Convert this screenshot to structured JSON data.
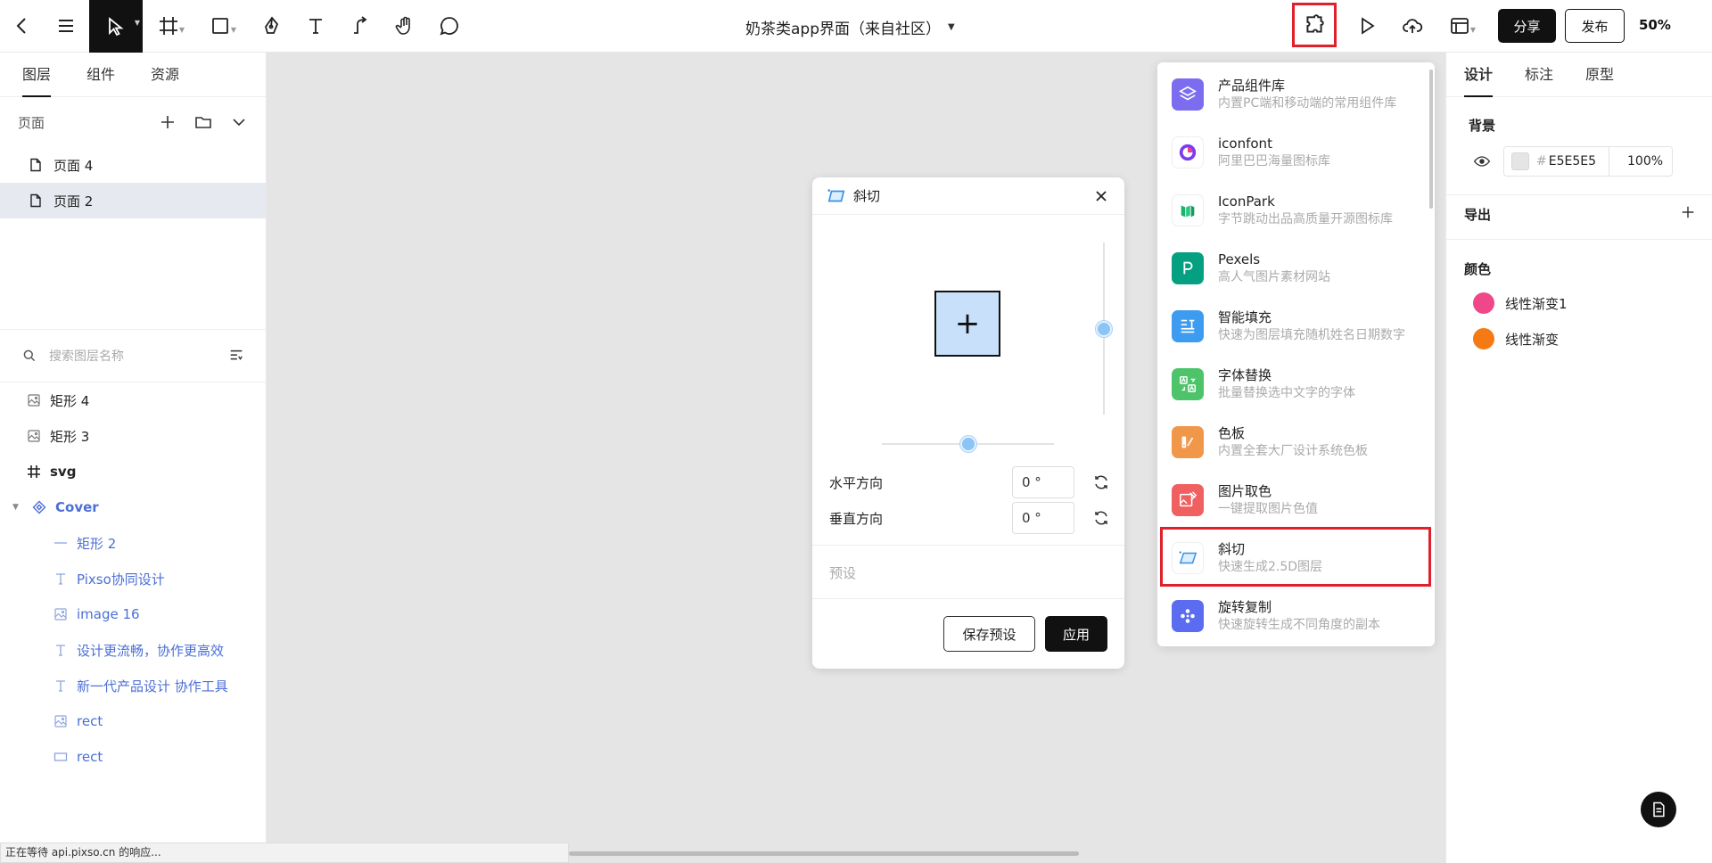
{
  "document": {
    "title": "奶茶类app界面（来自社区）"
  },
  "toolbar": {
    "share_label": "分享",
    "publish_label": "发布",
    "zoom": "50%"
  },
  "left_panel": {
    "tabs": [
      "图层",
      "组件",
      "资源"
    ],
    "pages_label": "页面",
    "pages": [
      {
        "name": "页面 4",
        "active": false
      },
      {
        "name": "页面 2",
        "active": true
      }
    ],
    "search_placeholder": "搜索图层名称",
    "layers": [
      {
        "name": "矩形 4",
        "icon": "image-icon",
        "indent": 0,
        "style": "normal"
      },
      {
        "name": "矩形 3",
        "icon": "image-icon",
        "indent": 0,
        "style": "normal"
      },
      {
        "name": "svg",
        "icon": "frame-icon",
        "indent": 0,
        "style": "bold"
      },
      {
        "name": "Cover",
        "icon": "component-icon",
        "indent": 0,
        "style": "blue-bold"
      },
      {
        "name": "矩形 2",
        "icon": "line-icon",
        "indent": 1,
        "style": "blue"
      },
      {
        "name": "Pixso协同设计",
        "icon": "text-icon",
        "indent": 1,
        "style": "blue"
      },
      {
        "name": "image 16",
        "icon": "image-icon",
        "indent": 1,
        "style": "blue"
      },
      {
        "name": "设计更流畅，协作更高效",
        "icon": "text-icon",
        "indent": 1,
        "style": "blue"
      },
      {
        "name": "新一代产品设计 协作工具",
        "icon": "text-icon",
        "indent": 1,
        "style": "blue"
      },
      {
        "name": "rect",
        "icon": "image-icon",
        "indent": 1,
        "style": "blue"
      },
      {
        "name": "rect",
        "icon": "rect-icon",
        "indent": 1,
        "style": "blue"
      }
    ]
  },
  "status_bar": {
    "text": "正在等待 api.pixso.cn 的响应..."
  },
  "skew_dialog": {
    "title": "斜切",
    "horizontal_label": "水平方向",
    "horizontal_value": "0 °",
    "vertical_label": "垂直方向",
    "vertical_value": "0 °",
    "preset_label": "预设",
    "save_preset_label": "保存预设",
    "apply_label": "应用",
    "horizontal_slider_fraction": 0.5,
    "vertical_slider_fraction": 0.5
  },
  "plugin_menu": {
    "items": [
      {
        "title": "产品组件库",
        "desc": "内置PC端和移动端的常用组件库",
        "icon": "layers-icon",
        "color": "#7b6cf0"
      },
      {
        "title": "iconfont",
        "desc": "阿里巴巴海量图标库",
        "icon": "iconfont-icon",
        "color": "#ffffff"
      },
      {
        "title": "IconPark",
        "desc": "字节跳动出品高质量开源图标库",
        "icon": "iconpark-icon",
        "color": "#ffffff"
      },
      {
        "title": "Pexels",
        "desc": "高人气图片素材网站",
        "icon": "pexels-icon",
        "color": "#05a081"
      },
      {
        "title": "智能填充",
        "desc": "快速为图层填充随机姓名日期数字",
        "icon": "fill-icon",
        "color": "#3d9cf0"
      },
      {
        "title": "字体替换",
        "desc": "批量替换选中文字的字体",
        "icon": "font-replace-icon",
        "color": "#4ec46a"
      },
      {
        "title": "色板",
        "desc": "内置全套大厂设计系统色板",
        "icon": "palette-icon",
        "color": "#f0974a"
      },
      {
        "title": "图片取色",
        "desc": "一键提取图片色值",
        "icon": "image-picker-icon",
        "color": "#f06060"
      },
      {
        "title": "斜切",
        "desc": "快速生成2.5D图层",
        "icon": "skew-icon",
        "color": "#ffffff"
      },
      {
        "title": "旋转复制",
        "desc": "快速旋转生成不同角度的副本",
        "icon": "rotate-copy-icon",
        "color": "#5b6cf0"
      }
    ]
  },
  "right_panel": {
    "tabs": [
      "设计",
      "标注",
      "原型"
    ],
    "background_label": "背景",
    "background_hex": "E5E5E5",
    "background_opacity": "100%",
    "export_label": "导出",
    "colors_label": "颜色",
    "colors": [
      {
        "name": "线性渐变1",
        "color": "#f0478a"
      },
      {
        "name": "线性渐变",
        "color": "#f57a14"
      }
    ]
  }
}
